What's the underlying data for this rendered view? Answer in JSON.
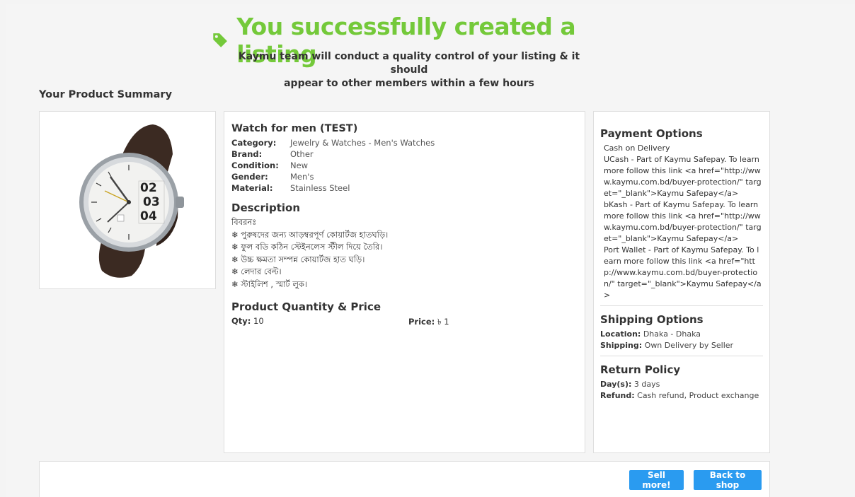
{
  "hero": {
    "title": "You successfully created a listing",
    "icon": "tag-icon",
    "subtitle_line1": "Kaymu team will conduct a quality control of your listing & it should",
    "subtitle_line2": "appear to other members within a few hours"
  },
  "summary_heading": "Your Product Summary",
  "product": {
    "image_icon": "watch-image",
    "title": "Watch for men (TEST)",
    "specs": [
      {
        "key": "Category:",
        "value": "Jewelry & Watches - Men's Watches"
      },
      {
        "key": "Brand:",
        "value": "Other"
      },
      {
        "key": "Condition:",
        "value": "New"
      },
      {
        "key": "Gender:",
        "value": "Men's"
      },
      {
        "key": "Material:",
        "value": "Stainless Steel"
      }
    ],
    "description_heading": "Description",
    "description_lines": [
      "বিবরনঃ",
      "❄ পুরুষদের জন্য আড়ম্বরপূর্ণ কোয়ার্টজ হাতঘড়ি।",
      "❄ ফুল বডি কঠিন স্টেইনলেস স্টীল দিয়ে তৈরি।",
      "❄ উচ্চ ক্ষমতা সম্পন্ন কোয়ার্টজ হাত ঘড়ি।",
      "❄ লেদার বেল্ট।",
      "❄ স্টাইলিশ , স্মার্ট লুক।"
    ],
    "qp_heading": "Product Quantity & Price",
    "qty_label": "Qty:",
    "qty_value": "10",
    "price_label": "Price:",
    "price_value": "৳ 1"
  },
  "payment": {
    "heading": "Payment Options",
    "lines": [
      "Cash on Delivery",
      "UCash - Part of Kaymu Safepay. To learn more follow this link <a href=\"http://www.kaymu.com.bd/buyer-protection/\" target=\"_blank\">Kaymu Safepay</a>",
      "bKash - Part of Kaymu Safepay. To learn more follow this link <a href=\"http://www.kaymu.com.bd/buyer-protection/\" target=\"_blank\">Kaymu Safepay</a>",
      "Port Wallet - Part of Kaymu Safepay. To learn more follow this link <a href=\"http://www.kaymu.com.bd/buyer-protection/\" target=\"_blank\">Kaymu Safepay</a>"
    ]
  },
  "shipping": {
    "heading": "Shipping Options",
    "location_label": "Location:",
    "location_value": "Dhaka - Dhaka",
    "shipping_label": "Shipping:",
    "shipping_value": "Own Delivery by Seller"
  },
  "returns": {
    "heading": "Return Policy",
    "days_label": "Day(s):",
    "days_value": "3 days",
    "refund_label": "Refund:",
    "refund_value": "Cash refund, Product exchange"
  },
  "actions": {
    "sell_more": "Sell more!",
    "back_to_shop": "Back to shop"
  },
  "colors": {
    "success_green": "#74c93a",
    "button_blue": "#2a9bf0"
  }
}
